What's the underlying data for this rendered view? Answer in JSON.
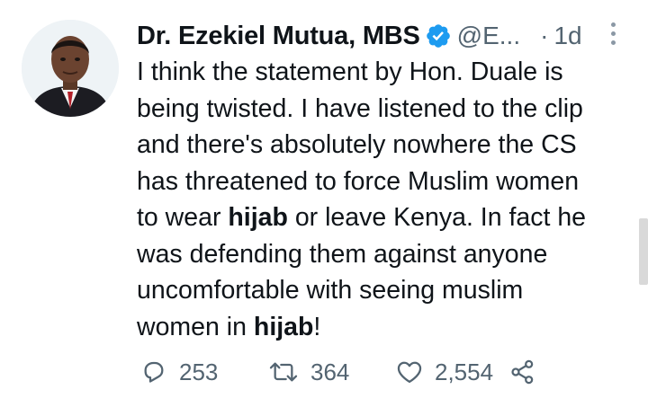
{
  "tweet": {
    "author": {
      "name": "Dr. Ezekiel Mutua, MBS",
      "handle": "@E...",
      "verified": true
    },
    "separator": "·",
    "time": "1d",
    "body": {
      "l1": "I think the statement by Hon. Duale is",
      "l2": "being twisted. I have listened to the clip",
      "l3": "and there's absolutely nowhere the CS",
      "l4": "has threatened to force Muslim women",
      "l5_pre": "to wear ",
      "l5_bold": "hijab",
      "l5_post": " or leave Kenya. In fact he",
      "l6": "was defending them against anyone",
      "l7": "uncomfortable with seeing muslim",
      "l8_pre": "women in ",
      "l8_bold": "hijab",
      "l8_post": "!"
    },
    "actions": {
      "replies": "253",
      "retweets": "364",
      "likes": "2,554"
    }
  },
  "colors": {
    "verified": "#1d9bf0",
    "secondary_text": "#536471",
    "primary_text": "#0f1419"
  },
  "icons": {
    "reply": "reply-icon",
    "retweet": "retweet-icon",
    "like": "heart-icon",
    "share": "share-icon",
    "more": "more-vertical-icon",
    "verified": "verified-badge-icon"
  }
}
